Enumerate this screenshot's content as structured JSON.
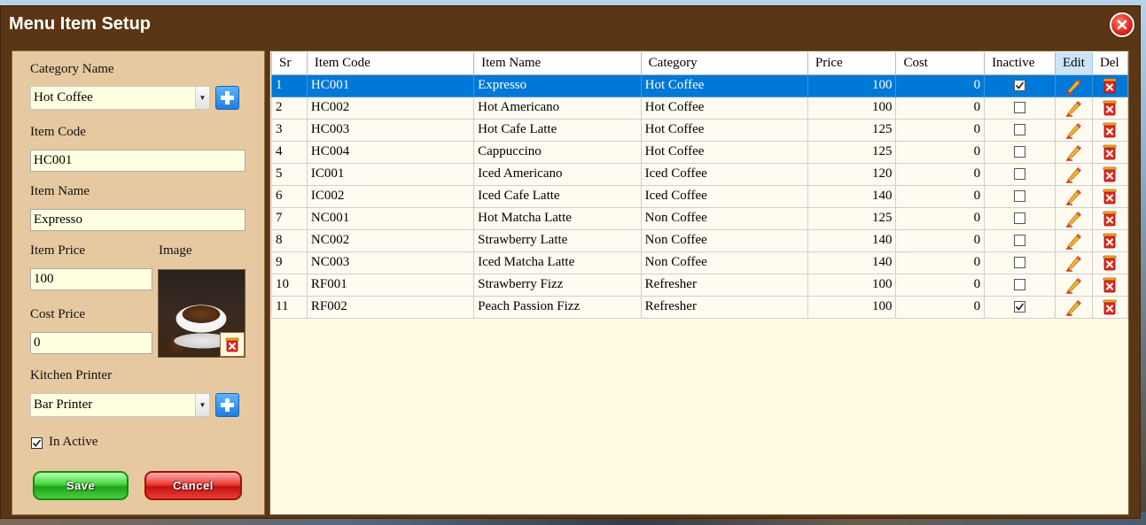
{
  "window": {
    "title": "Menu Item Setup"
  },
  "form": {
    "category_label": "Category Name",
    "category_value": "Hot Coffee",
    "item_code_label": "Item Code",
    "item_code_value": "HC001",
    "item_name_label": "Item Name",
    "item_name_value": "Expresso",
    "item_price_label": "Item Price",
    "item_price_value": "100",
    "image_label": "Image",
    "cost_price_label": "Cost Price",
    "cost_price_value": "0",
    "kitchen_printer_label": "Kitchen Printer",
    "kitchen_printer_value": "Bar Printer",
    "inactive_label": "In Active",
    "inactive_checked": true,
    "save_label": "Save",
    "cancel_label": "Cancel"
  },
  "grid": {
    "columns": [
      "Sr",
      "Item Code",
      "Item Name",
      "Category",
      "Price",
      "Cost",
      "Inactive",
      "Edit",
      "Del"
    ],
    "selected_row": 0,
    "rows": [
      {
        "sr": "1",
        "code": "HC001",
        "name": "Expresso",
        "category": "Hot Coffee",
        "price": "100",
        "cost": "0",
        "inactive": true
      },
      {
        "sr": "2",
        "code": "HC002",
        "name": "Hot Americano",
        "category": "Hot Coffee",
        "price": "100",
        "cost": "0",
        "inactive": false
      },
      {
        "sr": "3",
        "code": "HC003",
        "name": "Hot Cafe Latte",
        "category": "Hot Coffee",
        "price": "125",
        "cost": "0",
        "inactive": false
      },
      {
        "sr": "4",
        "code": "HC004",
        "name": "Cappuccino",
        "category": "Hot Coffee",
        "price": "125",
        "cost": "0",
        "inactive": false
      },
      {
        "sr": "5",
        "code": "IC001",
        "name": "Iced Americano",
        "category": "Iced Coffee",
        "price": "120",
        "cost": "0",
        "inactive": false
      },
      {
        "sr": "6",
        "code": "IC002",
        "name": "Iced Cafe Latte",
        "category": "Iced Coffee",
        "price": "140",
        "cost": "0",
        "inactive": false
      },
      {
        "sr": "7",
        "code": "NC001",
        "name": "Hot Matcha Latte",
        "category": "Non Coffee",
        "price": "125",
        "cost": "0",
        "inactive": false
      },
      {
        "sr": "8",
        "code": "NC002",
        "name": "Strawberry Latte",
        "category": "Non Coffee",
        "price": "140",
        "cost": "0",
        "inactive": false
      },
      {
        "sr": "9",
        "code": "NC003",
        "name": "Iced Matcha Latte",
        "category": "Non Coffee",
        "price": "140",
        "cost": "0",
        "inactive": false
      },
      {
        "sr": "10",
        "code": "RF001",
        "name": "Strawberry Fizz",
        "category": "Refresher",
        "price": "100",
        "cost": "0",
        "inactive": false
      },
      {
        "sr": "11",
        "code": "RF002",
        "name": "Peach Passion Fizz",
        "category": "Refresher",
        "price": "100",
        "cost": "0",
        "inactive": true
      }
    ]
  },
  "icons": {
    "close": "close-icon",
    "add": "plus-icon",
    "edit": "pencil-icon",
    "delete": "trash-icon",
    "dropdown": "chevron-down-icon"
  },
  "colors": {
    "titlebar": "#5b3615",
    "form_bg": "#e6c9a0",
    "grid_bg": "#fffbe0",
    "selection": "#0078d7",
    "input_bg": "#ffffe1"
  }
}
